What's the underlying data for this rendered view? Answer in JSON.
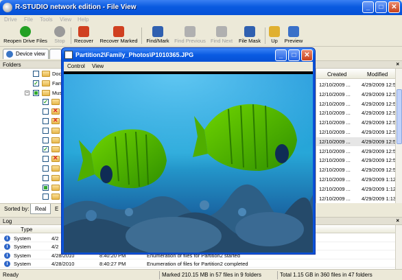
{
  "window": {
    "title": "R-STUDIO network edition - File View",
    "min": "_",
    "max": "□",
    "close": "✕"
  },
  "menu": [
    "Drive",
    "File",
    "Tools",
    "View",
    "Help"
  ],
  "toolbar": [
    {
      "label": "Reopen Drive Files",
      "icon": "reopen-icon",
      "color": "#23a023",
      "disabled": false
    },
    {
      "label": "Stop",
      "icon": "stop-icon",
      "color": "#9a9a9a",
      "disabled": true
    },
    {
      "label": "Recover",
      "icon": "recover-icon",
      "color": "#d04020",
      "disabled": false
    },
    {
      "label": "Recover Marked",
      "icon": "recover-marked-icon",
      "color": "#d04020",
      "disabled": false
    },
    {
      "label": "Find/Mark",
      "icon": "binoculars-icon",
      "color": "#3060b0",
      "disabled": false
    },
    {
      "label": "Find Previous",
      "icon": "find-previous-icon",
      "color": "#a0a0a0",
      "disabled": true
    },
    {
      "label": "Find Next",
      "icon": "find-next-icon",
      "color": "#a0a0a0",
      "disabled": true
    },
    {
      "label": "File Mask",
      "icon": "file-mask-icon",
      "color": "#3060b0",
      "disabled": false
    },
    {
      "label": "Up",
      "icon": "up-folder-icon",
      "color": "#e0b030",
      "disabled": false
    },
    {
      "label": "Preview",
      "icon": "preview-icon",
      "color": "#3a70c8",
      "disabled": false
    }
  ],
  "tabs": {
    "device_view": "Device view"
  },
  "folders": {
    "title": "Folders",
    "tree": [
      {
        "label": "Doc",
        "level": 2,
        "check": "none",
        "deleted": false,
        "expander": ""
      },
      {
        "label": "Fam",
        "level": 2,
        "check": "checked",
        "deleted": false,
        "expander": ""
      },
      {
        "label": "Mus",
        "level": 2,
        "check": "partial",
        "deleted": false,
        "expander": "−"
      },
      {
        "label": "",
        "level": 3,
        "check": "checked",
        "deleted": false,
        "expander": ""
      },
      {
        "label": "",
        "level": 3,
        "check": "none",
        "deleted": true,
        "expander": ""
      },
      {
        "label": "",
        "level": 3,
        "check": "none",
        "deleted": true,
        "expander": ""
      },
      {
        "label": "",
        "level": 3,
        "check": "none",
        "deleted": false,
        "expander": ""
      },
      {
        "label": "",
        "level": 3,
        "check": "none",
        "deleted": false,
        "expander": ""
      },
      {
        "label": "",
        "level": 3,
        "check": "checked",
        "deleted": false,
        "expander": ""
      },
      {
        "label": "",
        "level": 3,
        "check": "none",
        "deleted": true,
        "expander": ""
      },
      {
        "label": "",
        "level": 3,
        "check": "none",
        "deleted": false,
        "expander": ""
      },
      {
        "label": "",
        "level": 3,
        "check": "none",
        "deleted": false,
        "expander": ""
      },
      {
        "label": "",
        "level": 3,
        "check": "partial",
        "deleted": false,
        "expander": ""
      },
      {
        "label": "",
        "level": 3,
        "check": "none",
        "deleted": false,
        "expander": ""
      }
    ]
  },
  "file_list": {
    "columns": [
      "Created",
      "Modified"
    ],
    "rows": [
      {
        "created": "12/10/2009 ...",
        "modified": "4/29/2009 12:5",
        "selected": false
      },
      {
        "created": "12/10/2009 ...",
        "modified": "4/29/2009 12:5",
        "selected": false
      },
      {
        "created": "12/10/2009 ...",
        "modified": "4/29/2009 12:5",
        "selected": false
      },
      {
        "created": "12/10/2009 ...",
        "modified": "4/29/2009 12:5",
        "selected": false
      },
      {
        "created": "12/10/2009 ...",
        "modified": "4/29/2009 12:5",
        "selected": false
      },
      {
        "created": "12/10/2009 ...",
        "modified": "4/29/2009 12:5",
        "selected": false
      },
      {
        "created": "12/10/2009 ...",
        "modified": "4/29/2009 12:5",
        "selected": true
      },
      {
        "created": "12/10/2009 ...",
        "modified": "4/29/2009 12:5",
        "selected": false
      },
      {
        "created": "12/10/2009 ...",
        "modified": "4/29/2009 12:5",
        "selected": false
      },
      {
        "created": "12/10/2009 ...",
        "modified": "4/29/2009 12:5",
        "selected": false
      },
      {
        "created": "12/10/2009 ...",
        "modified": "4/29/2009 1:12",
        "selected": false
      },
      {
        "created": "12/10/2009 ...",
        "modified": "4/29/2009 1:12",
        "selected": false
      },
      {
        "created": "12/10/2009 ...",
        "modified": "4/29/2009 1:13",
        "selected": false
      }
    ]
  },
  "sort": {
    "label": "Sorted by:",
    "active": "Real",
    "other": "E"
  },
  "viewer": {
    "title": "Partition2\\Family_Photos\\P1010365.JPG",
    "menu": [
      "Control",
      "View"
    ]
  },
  "log": {
    "title": "Log",
    "columns": [
      "Type"
    ],
    "rows": [
      {
        "type": "System",
        "date": "4/2",
        "time": "",
        "text": ""
      },
      {
        "type": "System",
        "date": "4/2",
        "time": "",
        "text": ""
      },
      {
        "type": "System",
        "date": "4/28/2010",
        "time": "8:40:20 PM",
        "text": "Enumeration of files for Partition2 started"
      },
      {
        "type": "System",
        "date": "4/28/2010",
        "time": "8:40:27 PM",
        "text": "Enumeration of files for Partition2 completed"
      }
    ]
  },
  "status": {
    "ready": "Ready",
    "marked": "Marked 210.15 MB in 57 files in 9 folders",
    "total": "Total 1.15 GB in 360 files in 47 folders"
  }
}
